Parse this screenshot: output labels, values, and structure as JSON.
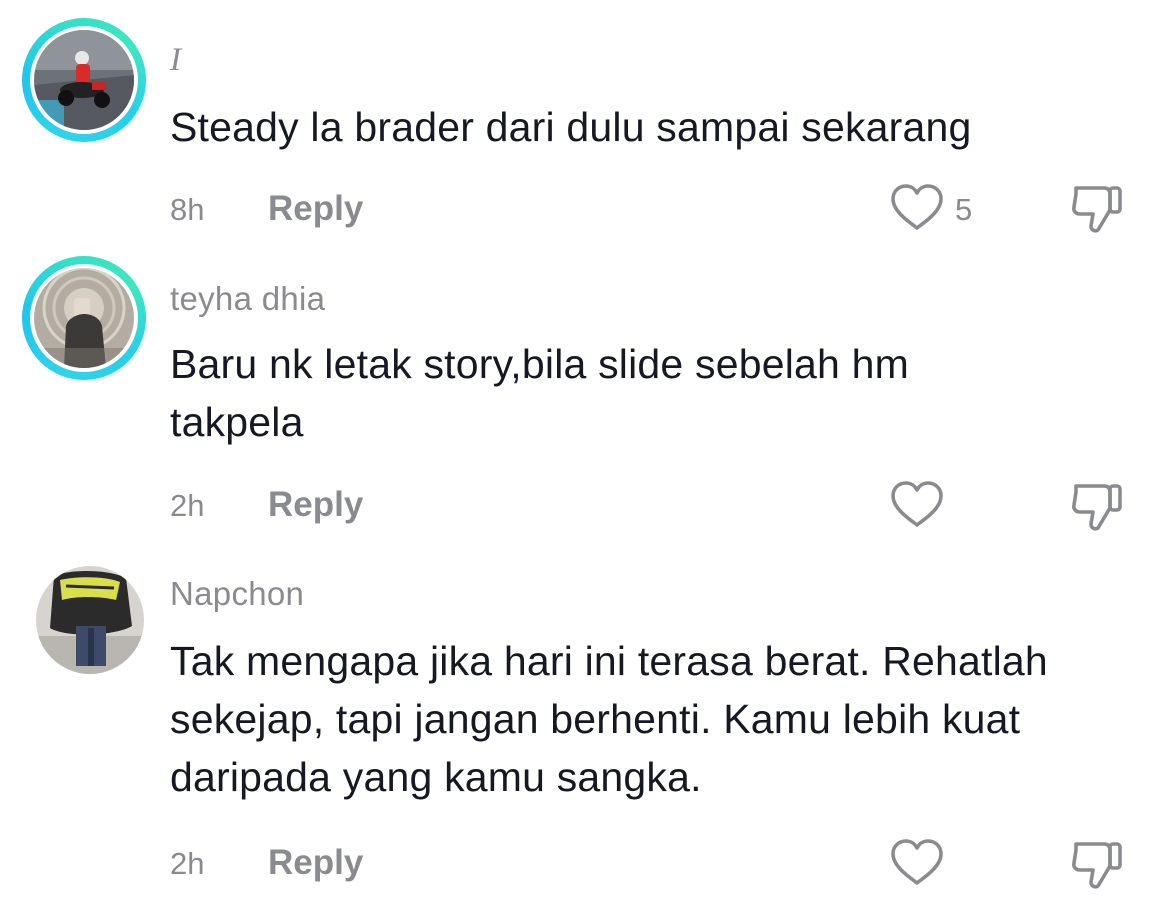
{
  "comments": [
    {
      "username": "I",
      "text": "Steady la brader dari dulu sampai sekarang",
      "time": "8h",
      "reply_label": "Reply",
      "like_count": "5",
      "has_story_ring": true,
      "avatar": "avatar-motorcycle-rider"
    },
    {
      "username": "teyha dhia",
      "text": "Baru nk letak story,bila slide sebelah hm takpela",
      "time": "2h",
      "reply_label": "Reply",
      "like_count": "",
      "has_story_ring": true,
      "avatar": "avatar-mirror-selfie"
    },
    {
      "username": "Napchon",
      "text": "Tak mengapa jika hari ini terasa berat. Rehatlah sekejap, tapi jangan berhenti. Kamu lebih kuat daripada yang kamu sangka.",
      "time": "2h",
      "reply_label": "Reply",
      "like_count": "",
      "has_story_ring": false,
      "avatar": "avatar-graphic-tee"
    }
  ],
  "icons": {
    "like": "heart-outline-icon",
    "dislike": "thumbs-down-outline-icon"
  },
  "colors": {
    "story_ring": "#2fd4e8",
    "secondary_text": "#8a8b91",
    "primary_text": "#161823",
    "background": "#ffffff"
  }
}
